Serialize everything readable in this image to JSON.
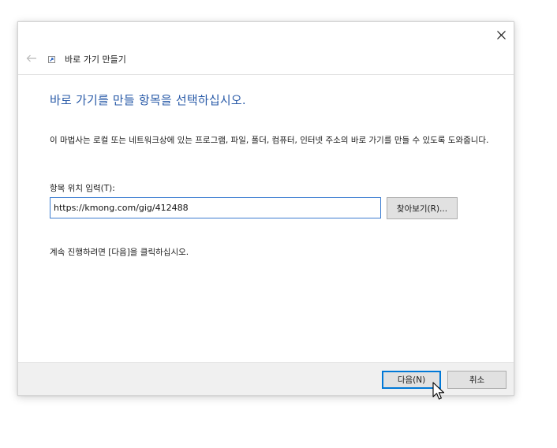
{
  "window": {
    "title": "바로 가기 만들기",
    "icons": {
      "close": "close-icon",
      "back": "back-arrow-icon",
      "wizard": "shortcut-icon"
    }
  },
  "main": {
    "heading": "바로 가기를 만들 항목을 선택하십시오.",
    "description": "이 마법사는 로컬 또는 네트워크상에 있는 프로그램, 파일, 폴더, 컴퓨터, 인터넷 주소의 바로 가기를 만들 수 있도록 도와줍니다.",
    "field_label": "항목 위치 입력(T):",
    "location_value": "https://kmong.com/gig/412488",
    "browse_label": "찾아보기(R)...",
    "continue_text": "계속 진행하려면 [다음]을 클릭하십시오."
  },
  "footer": {
    "next_label": "다음(N)",
    "cancel_label": "취소"
  },
  "colors": {
    "heading": "#2a5ba8",
    "focus_border": "#0078d7",
    "footer_bg": "#f0f0f0"
  }
}
